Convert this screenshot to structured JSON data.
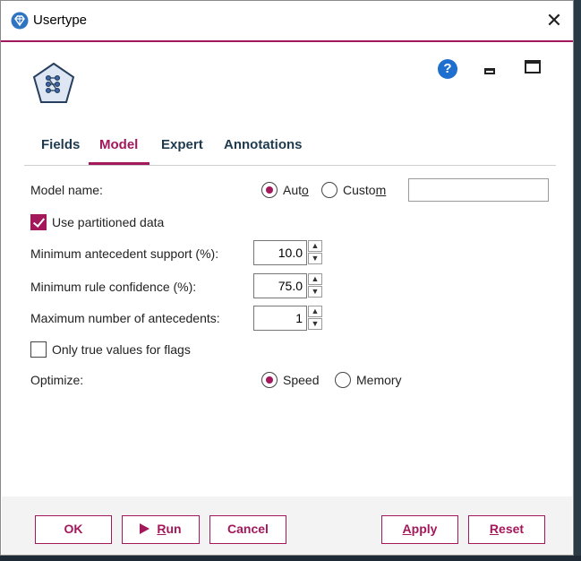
{
  "window": {
    "title": "Usertype"
  },
  "icons": {
    "title": "node-diamond-icon",
    "node": "association-rules-node-icon",
    "help": "?"
  },
  "tabs": [
    {
      "label": "Fields"
    },
    {
      "label": "Model",
      "active": true
    },
    {
      "label": "Expert"
    },
    {
      "label": "Annotations"
    }
  ],
  "form": {
    "model_name_label": "Model name:",
    "model_name_auto": {
      "pre": "Aut",
      "u": "o",
      "post": "",
      "selected": true
    },
    "model_name_custom": {
      "pre": "Custo",
      "u": "m",
      "post": "",
      "selected": false
    },
    "custom_name_value": "",
    "use_partitioned": {
      "label": "Use partitioned data",
      "checked": true
    },
    "min_antecedent_support": {
      "label": "Minimum antecedent support (%):",
      "value": "10.0"
    },
    "min_rule_confidence": {
      "label": "Minimum rule confidence (%):",
      "value": "75.0"
    },
    "max_antecedents": {
      "label": "Maximum number of antecedents:",
      "value": "1"
    },
    "only_true_flags": {
      "label": "Only true values for flags",
      "checked": false
    },
    "optimize_label": "Optimize:",
    "optimize_speed": {
      "label": "Speed",
      "selected": true
    },
    "optimize_memory": {
      "label": "Memory",
      "selected": false
    }
  },
  "buttons": {
    "ok": "OK",
    "run": {
      "pre": "",
      "u": "R",
      "post": "un"
    },
    "cancel": "Cancel",
    "apply": {
      "pre": "",
      "u": "A",
      "post": "pply"
    },
    "reset": {
      "pre": "",
      "u": "R",
      "post": "eset"
    }
  },
  "colors": {
    "accent": "#a3185b",
    "help": "#1f6fce"
  }
}
